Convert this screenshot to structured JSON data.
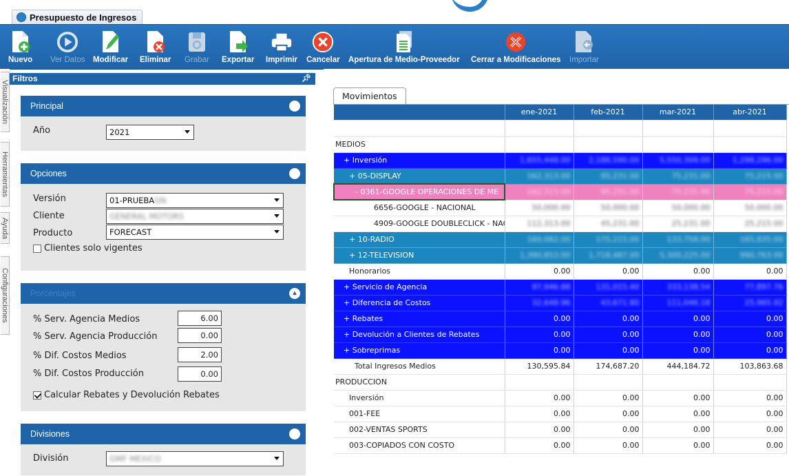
{
  "window": {
    "tab_title": "Presupuesto de Ingresos"
  },
  "toolbar": {
    "buttons": [
      {
        "label": "Nuevo",
        "icon": "new-document-icon",
        "enabled": true
      },
      {
        "label": "Ver Datos",
        "icon": "play-circle-icon",
        "enabled": false
      },
      {
        "label": "Modificar",
        "icon": "edit-document-icon",
        "enabled": true
      },
      {
        "label": "Eliminar",
        "icon": "delete-document-icon",
        "enabled": true
      },
      {
        "label": "Grabar",
        "icon": "save-icon",
        "enabled": false
      },
      {
        "label": "Exportar",
        "icon": "export-document-icon",
        "enabled": true
      },
      {
        "label": "Imprimir",
        "icon": "printer-icon",
        "enabled": true
      },
      {
        "label": "Cancelar",
        "icon": "cancel-circle-icon",
        "enabled": true
      },
      {
        "label": "Apertura de Medio-Proveedor",
        "icon": "document-list-icon",
        "enabled": true
      },
      {
        "label": "Cerrar a Modificaciones",
        "icon": "close-modifications-icon",
        "enabled": true
      },
      {
        "label": "Importar",
        "icon": "import-document-icon",
        "enabled": false
      }
    ]
  },
  "side_tabs": [
    "Visualización",
    "Herramientas",
    "Ayuda",
    "Configuraciones"
  ],
  "filters": {
    "title": "Filtros",
    "principal": {
      "title": "Principal",
      "anio_label": "Año",
      "anio_value": "2021"
    },
    "opciones": {
      "title": "Opciones",
      "version_label": "Versión",
      "version_value": "01-PRUEBA",
      "version_hidden": "GN",
      "cliente_label": "Cliente",
      "cliente_value": "GENERAL MOTORS",
      "producto_label": "Producto",
      "producto_value": "FORECAST",
      "vigentes_label": "Clientes solo vigentes",
      "vigentes_checked": false
    },
    "porcentajes": {
      "title": "Porcentajes",
      "fields": [
        {
          "label": "% Serv. Agencia Medios",
          "value": "6.00"
        },
        {
          "label": "% Serv. Agencia Producción",
          "value": "0.00"
        },
        {
          "label": "% Dif. Costos Medios",
          "value": "2.00"
        },
        {
          "label": "% Dif. Costos Producción",
          "value": "0.00"
        }
      ],
      "rebates_label": "Calcular Rebates y Devolución Rebates",
      "rebates_checked": true
    },
    "divisiones": {
      "title": "Divisiones",
      "division_label": "División",
      "division_value": "GMF MEXICO"
    }
  },
  "movimientos": {
    "tab_label": "Movimientos",
    "columns": [
      "ene-2021",
      "feb-2021",
      "mar-2021",
      "abr-2021"
    ],
    "rows": [
      {
        "label": "",
        "values": [
          "",
          "",
          "",
          ""
        ],
        "style": "blank",
        "blur": false
      },
      {
        "label": "MEDIOS",
        "values": [
          "",
          "",
          "",
          ""
        ],
        "style": "plain",
        "blur": false
      },
      {
        "label": "+ Inversión",
        "values": [
          "1,655,448.00",
          "2,188,590.00",
          "5,550,309.00",
          "1,298,296.00"
        ],
        "style": "blue",
        "blur": true
      },
      {
        "label": "+ 05-DISPLAY",
        "values": [
          "162,313.00",
          "95,231.00",
          "75,231.00",
          "75,215.00"
        ],
        "style": "teal",
        "blur": true
      },
      {
        "label": "- 0361-GOOGLE OPERACIONES DE ME",
        "values": [
          "162,313.00",
          "95,231.00",
          "75,231.00",
          "75,215.00"
        ],
        "style": "pink",
        "blur": true
      },
      {
        "label": "6656-GOOGLE - NACIONAL",
        "values": [
          "50,000.00",
          "50,000.00",
          "50,000.00",
          "50,000.00"
        ],
        "style": "plain",
        "blur": true
      },
      {
        "label": "4909-GOOGLE DOUBLECLICK - NAC",
        "values": [
          "112,313.00",
          "45,231.00",
          "25,231.00",
          "25,215.00"
        ],
        "style": "plain",
        "blur": true
      },
      {
        "label": "+ 10-RADIO",
        "values": [
          "160,082.00",
          "175,215.00",
          "133,758.00",
          "165,835.00"
        ],
        "style": "teal",
        "blur": true
      },
      {
        "label": "+ 12-TELEVISION",
        "values": [
          "1,390,853.00",
          "1,718,487.00",
          "5,300,225.00",
          "990,763.00"
        ],
        "style": "teal",
        "blur": true
      },
      {
        "label": "Honorarios",
        "values": [
          "0.00",
          "0.00",
          "0.00",
          "0.00"
        ],
        "style": "plain",
        "blur": false
      },
      {
        "label": "+ Servicio de Agencia",
        "values": [
          "97,946.88",
          "131,015.40",
          "333,138.54",
          "77,897.76"
        ],
        "style": "blue",
        "blur": true
      },
      {
        "label": "+ Diferencia de Costos",
        "values": [
          "32,648.96",
          "43,671.80",
          "111,046.18",
          "25,965.92"
        ],
        "style": "blue",
        "blur": true
      },
      {
        "label": "+ Rebates",
        "values": [
          "0.00",
          "0.00",
          "0.00",
          "0.00"
        ],
        "style": "blue",
        "blur": false
      },
      {
        "label": "+ Devolución a Clientes de Rebates",
        "values": [
          "0.00",
          "0.00",
          "0.00",
          "0.00"
        ],
        "style": "blue",
        "blur": false
      },
      {
        "label": "+ Sobreprimas",
        "values": [
          "0.00",
          "0.00",
          "0.00",
          "0.00"
        ],
        "style": "blue",
        "blur": false
      },
      {
        "label": "Total Ingresos Medios",
        "values": [
          "130,595.84",
          "174,687.20",
          "444,184.72",
          "103,863.68"
        ],
        "style": "plain",
        "blur": false
      },
      {
        "label": "PRODUCCION",
        "values": [
          "",
          "",
          "",
          ""
        ],
        "style": "plain",
        "blur": false
      },
      {
        "label": "Inversión",
        "values": [
          "0.00",
          "0.00",
          "0.00",
          "0.00"
        ],
        "style": "plain",
        "blur": false
      },
      {
        "label": "001-FEE",
        "values": [
          "0.00",
          "0.00",
          "0.00",
          "0.00"
        ],
        "style": "plain",
        "blur": false
      },
      {
        "label": "002-VENTAS SPORTS",
        "values": [
          "0.00",
          "0.00",
          "0.00",
          "0.00"
        ],
        "style": "plain",
        "blur": false
      },
      {
        "label": "003-COPIADOS CON COSTO",
        "values": [
          "0.00",
          "0.00",
          "0.00",
          "0.00"
        ],
        "style": "plain",
        "blur": false
      }
    ]
  },
  "colors": {
    "toolbar_blue": "#1f63a8",
    "row_blue": "#0a12ff",
    "row_teal": "#1c87bf",
    "row_pink": "#f081bf"
  }
}
